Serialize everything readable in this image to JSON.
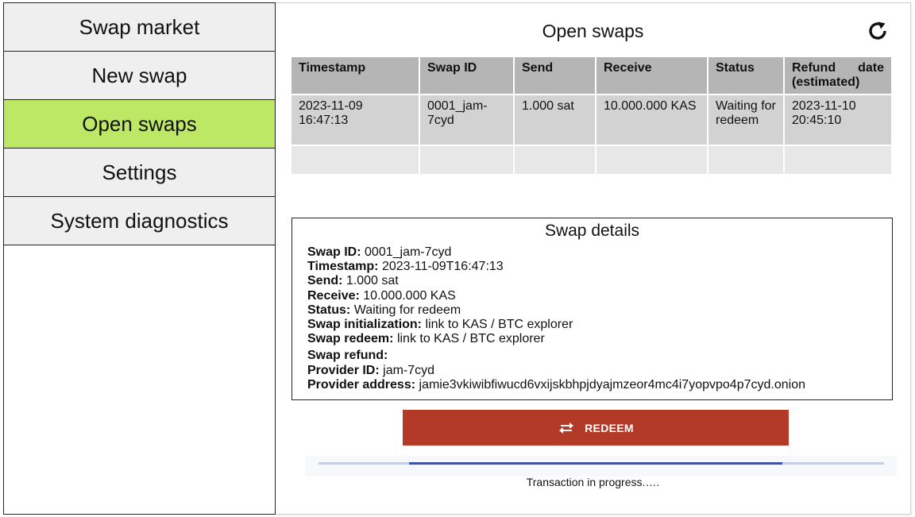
{
  "sidebar": {
    "items": [
      {
        "label": "Swap market"
      },
      {
        "label": "New swap"
      },
      {
        "label": "Open swaps"
      },
      {
        "label": "Settings"
      },
      {
        "label": "System diagnostics"
      }
    ],
    "active_item": "Open swaps",
    "active_color": "#bde866"
  },
  "main": {
    "title": "Open swaps",
    "refresh_icon": "refresh-icon"
  },
  "table": {
    "headers": {
      "timestamp": "Timestamp",
      "swap_id": "Swap ID",
      "send": "Send",
      "receive": "Receive",
      "status": "Status",
      "refund_word1": "Refund",
      "refund_word2": "date",
      "refund_line2": "(estimated)"
    },
    "rows": [
      {
        "timestamp": "2023-11-09 16:47:13",
        "swap_id": "0001_jam-7cyd",
        "send": "1.000 sat",
        "receive": "10.000.000 KAS",
        "status": "Waiting for redeem",
        "refund_date": "2023-11-10 20:45:10"
      }
    ]
  },
  "details": {
    "title": "Swap details",
    "swap_id_label": "Swap ID:",
    "swap_id": "0001_jam-7cyd",
    "timestamp_label": "Timestamp:",
    "timestamp": "2023-11-09T16:47:13",
    "send_label": "Send:",
    "send": "1.000 sat",
    "receive_label": "Receive:",
    "receive": "10.000.000 KAS",
    "status_label": "Status:",
    "status": "Waiting for redeem",
    "init_label": "Swap initialization:",
    "init": "link to KAS / BTC explorer",
    "redeem_label": "Swap redeem:",
    "redeem": "link to KAS / BTC explorer",
    "refund_label": "Swap refund:",
    "provider_id_label": "Provider ID:",
    "provider_id": "jam-7cyd",
    "provider_address_label": "Provider address:",
    "provider_address": "jamie3vkiwibfiwucd6vxijskbhpjdyajmzeor4mc4i7yopvpo4p7cyd.onion"
  },
  "redeem_button": {
    "label": "REDEEM",
    "icon": "swap-arrows-icon",
    "color": "#b23a27"
  },
  "progress": {
    "text": "Transaction in progress.….",
    "start_fraction": 0.16,
    "end_fraction": 0.82,
    "color": "#3f51a5"
  }
}
